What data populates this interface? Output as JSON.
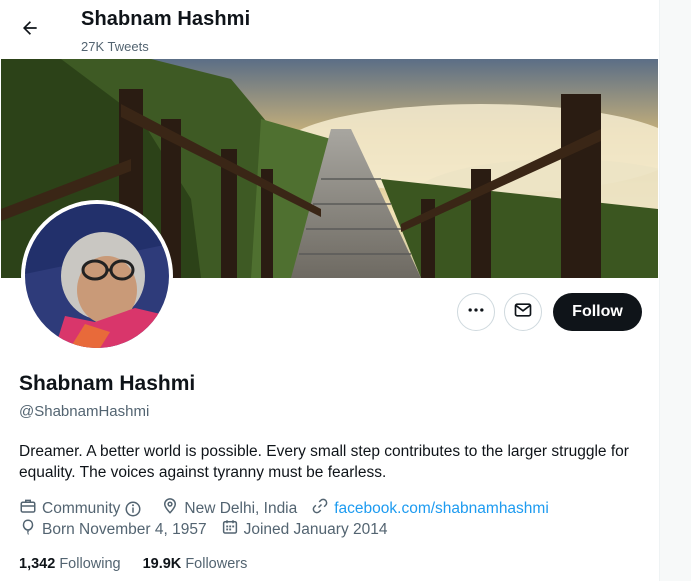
{
  "header": {
    "title": "Shabnam Hashmi",
    "subtitle": "27K Tweets"
  },
  "profile": {
    "name": "Shabnam Hashmi",
    "handle": "@ShabnamHashmi",
    "bio": "Dreamer. A better world is possible. Every small step contributes to the larger struggle for equality. The voices against tyranny must be fearless.",
    "category": "Community",
    "location": "New Delhi, India",
    "website": "facebook.com/shabnamhashmi",
    "birthday": "Born November 4, 1957",
    "joined": "Joined January 2014"
  },
  "actions": {
    "follow_label": "Follow"
  },
  "stats": {
    "following_count": "1,342",
    "following_label": "Following",
    "followers_count": "19.9K",
    "followers_label": "Followers"
  },
  "icons": {
    "back": "arrow-left-icon",
    "more": "more-dots-icon",
    "message": "envelope-icon",
    "category": "briefcase-icon",
    "info": "info-circle-icon",
    "location": "location-pin-icon",
    "link": "link-icon",
    "birthday": "balloon-icon",
    "joined": "calendar-icon"
  },
  "colors": {
    "text": "#0f1419",
    "secondary": "#536471",
    "link": "#1d9bf0",
    "follow_bg": "#0f1419"
  }
}
